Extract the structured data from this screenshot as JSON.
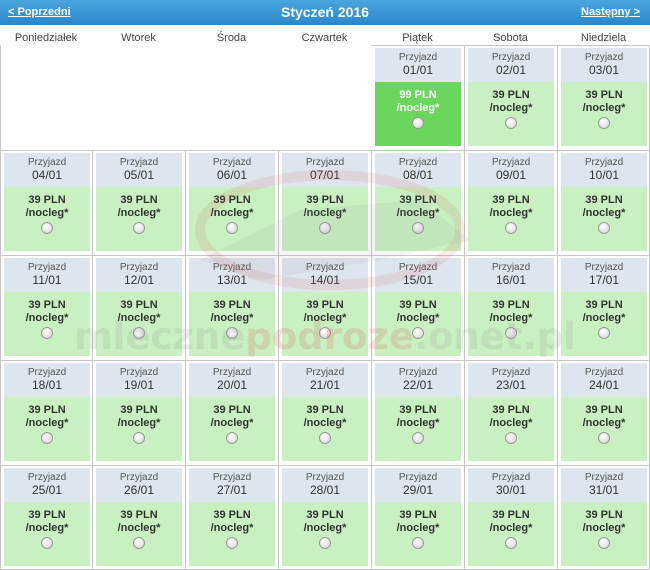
{
  "nav": {
    "prev": "< Poprzedni",
    "title": "Styczeń 2016",
    "next": "Następny >"
  },
  "weekdays": [
    "Poniedziałek",
    "Wtorek",
    "Środa",
    "Czwartek",
    "Piątek",
    "Sobota",
    "Niedziela"
  ],
  "cell_label": "Przyjazd",
  "per_night": "/nocleg*",
  "watermark": {
    "part1": "mleczne",
    "part2": "podroze",
    "part3": ".onet.pl"
  },
  "colors": {
    "header": "#2a86c8",
    "day_top": "#dde5ee",
    "available": "#c8f0c0",
    "selected": "#6ad75c"
  },
  "days": [
    {
      "date": "01/01",
      "price": "99 PLN",
      "selected": true
    },
    {
      "date": "02/01",
      "price": "39 PLN"
    },
    {
      "date": "03/01",
      "price": "39 PLN"
    },
    {
      "date": "04/01",
      "price": "39 PLN"
    },
    {
      "date": "05/01",
      "price": "39 PLN"
    },
    {
      "date": "06/01",
      "price": "39 PLN"
    },
    {
      "date": "07/01",
      "price": "39 PLN"
    },
    {
      "date": "08/01",
      "price": "39 PLN"
    },
    {
      "date": "09/01",
      "price": "39 PLN"
    },
    {
      "date": "10/01",
      "price": "39 PLN"
    },
    {
      "date": "11/01",
      "price": "39 PLN"
    },
    {
      "date": "12/01",
      "price": "39 PLN"
    },
    {
      "date": "13/01",
      "price": "39 PLN"
    },
    {
      "date": "14/01",
      "price": "39 PLN"
    },
    {
      "date": "15/01",
      "price": "39 PLN"
    },
    {
      "date": "16/01",
      "price": "39 PLN"
    },
    {
      "date": "17/01",
      "price": "39 PLN"
    },
    {
      "date": "18/01",
      "price": "39 PLN"
    },
    {
      "date": "19/01",
      "price": "39 PLN"
    },
    {
      "date": "20/01",
      "price": "39 PLN"
    },
    {
      "date": "21/01",
      "price": "39 PLN"
    },
    {
      "date": "22/01",
      "price": "39 PLN"
    },
    {
      "date": "23/01",
      "price": "39 PLN"
    },
    {
      "date": "24/01",
      "price": "39 PLN"
    },
    {
      "date": "25/01",
      "price": "39 PLN"
    },
    {
      "date": "26/01",
      "price": "39 PLN"
    },
    {
      "date": "27/01",
      "price": "39 PLN"
    },
    {
      "date": "28/01",
      "price": "39 PLN"
    },
    {
      "date": "29/01",
      "price": "39 PLN"
    },
    {
      "date": "30/01",
      "price": "39 PLN"
    },
    {
      "date": "31/01",
      "price": "39 PLN"
    }
  ]
}
